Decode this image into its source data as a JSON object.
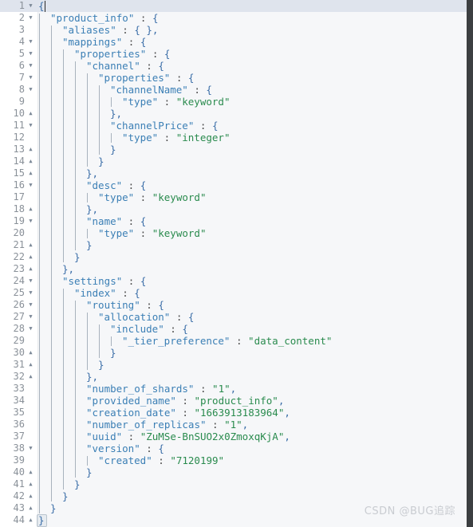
{
  "editor": {
    "language": "json",
    "total_lines": 44,
    "active_line": 1,
    "line_height": 15,
    "colors": {
      "background": "#f6f7f9",
      "gutter_background": "#ffffff",
      "active_line": "#dfe4ed",
      "line_number": "#8a9199",
      "key": "#3b7fb5",
      "string": "#2a8b4e",
      "punctuation": "#4a4a4a",
      "brace": "#3b6ea8",
      "indent_guide": "#a8b2bd",
      "right_bar": "#3c3f41"
    },
    "fold_open_glyph": "▼",
    "fold_close_glyph": "▲"
  },
  "watermark": {
    "text": "CSDN @BUG追踪"
  },
  "lines": [
    {
      "n": 1,
      "fold": "open",
      "indent": 0,
      "text": "{",
      "tokens": [
        {
          "t": "{",
          "c": "b"
        }
      ]
    },
    {
      "n": 2,
      "fold": "open",
      "indent": 1,
      "text": "\"product_info\" : {",
      "tokens": [
        {
          "t": "\"product_info\"",
          "c": "k"
        },
        {
          "t": " : ",
          "c": "p"
        },
        {
          "t": "{",
          "c": "b"
        }
      ]
    },
    {
      "n": 3,
      "fold": "none",
      "indent": 2,
      "text": "\"aliases\" : { },",
      "tokens": [
        {
          "t": "\"aliases\"",
          "c": "k"
        },
        {
          "t": " : ",
          "c": "p"
        },
        {
          "t": "{ }",
          "c": "b"
        },
        {
          "t": ",",
          "c": "c"
        }
      ]
    },
    {
      "n": 4,
      "fold": "open",
      "indent": 2,
      "text": "\"mappings\" : {",
      "tokens": [
        {
          "t": "\"mappings\"",
          "c": "k"
        },
        {
          "t": " : ",
          "c": "p"
        },
        {
          "t": "{",
          "c": "b"
        }
      ]
    },
    {
      "n": 5,
      "fold": "open",
      "indent": 3,
      "text": "\"properties\" : {",
      "tokens": [
        {
          "t": "\"properties\"",
          "c": "k"
        },
        {
          "t": " : ",
          "c": "p"
        },
        {
          "t": "{",
          "c": "b"
        }
      ]
    },
    {
      "n": 6,
      "fold": "open",
      "indent": 4,
      "text": "\"channel\" : {",
      "tokens": [
        {
          "t": "\"channel\"",
          "c": "k"
        },
        {
          "t": " : ",
          "c": "p"
        },
        {
          "t": "{",
          "c": "b"
        }
      ]
    },
    {
      "n": 7,
      "fold": "open",
      "indent": 5,
      "text": "\"properties\" : {",
      "tokens": [
        {
          "t": "\"properties\"",
          "c": "k"
        },
        {
          "t": " : ",
          "c": "p"
        },
        {
          "t": "{",
          "c": "b"
        }
      ]
    },
    {
      "n": 8,
      "fold": "open",
      "indent": 6,
      "text": "\"channelName\" : {",
      "tokens": [
        {
          "t": "\"channelName\"",
          "c": "k"
        },
        {
          "t": " : ",
          "c": "p"
        },
        {
          "t": "{",
          "c": "b"
        }
      ]
    },
    {
      "n": 9,
      "fold": "none",
      "indent": 7,
      "text": "\"type\" : \"keyword\"",
      "tokens": [
        {
          "t": "\"type\"",
          "c": "k"
        },
        {
          "t": " : ",
          "c": "p"
        },
        {
          "t": "\"keyword\"",
          "c": "s"
        }
      ]
    },
    {
      "n": 10,
      "fold": "close",
      "indent": 6,
      "text": "},",
      "tokens": [
        {
          "t": "}",
          "c": "b"
        },
        {
          "t": ",",
          "c": "c"
        }
      ]
    },
    {
      "n": 11,
      "fold": "open",
      "indent": 6,
      "text": "\"channelPrice\" : {",
      "tokens": [
        {
          "t": "\"channelPrice\"",
          "c": "k"
        },
        {
          "t": " : ",
          "c": "p"
        },
        {
          "t": "{",
          "c": "b"
        }
      ]
    },
    {
      "n": 12,
      "fold": "none",
      "indent": 7,
      "text": "\"type\" : \"integer\"",
      "tokens": [
        {
          "t": "\"type\"",
          "c": "k"
        },
        {
          "t": " : ",
          "c": "p"
        },
        {
          "t": "\"integer\"",
          "c": "s"
        }
      ]
    },
    {
      "n": 13,
      "fold": "close",
      "indent": 6,
      "text": "}",
      "tokens": [
        {
          "t": "}",
          "c": "b"
        }
      ]
    },
    {
      "n": 14,
      "fold": "close",
      "indent": 5,
      "text": "}",
      "tokens": [
        {
          "t": "}",
          "c": "b"
        }
      ]
    },
    {
      "n": 15,
      "fold": "close",
      "indent": 4,
      "text": "},",
      "tokens": [
        {
          "t": "}",
          "c": "b"
        },
        {
          "t": ",",
          "c": "c"
        }
      ]
    },
    {
      "n": 16,
      "fold": "open",
      "indent": 4,
      "text": "\"desc\" : {",
      "tokens": [
        {
          "t": "\"desc\"",
          "c": "k"
        },
        {
          "t": " : ",
          "c": "p"
        },
        {
          "t": "{",
          "c": "b"
        }
      ]
    },
    {
      "n": 17,
      "fold": "none",
      "indent": 5,
      "text": "\"type\" : \"keyword\"",
      "tokens": [
        {
          "t": "\"type\"",
          "c": "k"
        },
        {
          "t": " : ",
          "c": "p"
        },
        {
          "t": "\"keyword\"",
          "c": "s"
        }
      ]
    },
    {
      "n": 18,
      "fold": "close",
      "indent": 4,
      "text": "},",
      "tokens": [
        {
          "t": "}",
          "c": "b"
        },
        {
          "t": ",",
          "c": "c"
        }
      ]
    },
    {
      "n": 19,
      "fold": "open",
      "indent": 4,
      "text": "\"name\" : {",
      "tokens": [
        {
          "t": "\"name\"",
          "c": "k"
        },
        {
          "t": " : ",
          "c": "p"
        },
        {
          "t": "{",
          "c": "b"
        }
      ]
    },
    {
      "n": 20,
      "fold": "none",
      "indent": 5,
      "text": "\"type\" : \"keyword\"",
      "tokens": [
        {
          "t": "\"type\"",
          "c": "k"
        },
        {
          "t": " : ",
          "c": "p"
        },
        {
          "t": "\"keyword\"",
          "c": "s"
        }
      ]
    },
    {
      "n": 21,
      "fold": "close",
      "indent": 4,
      "text": "}",
      "tokens": [
        {
          "t": "}",
          "c": "b"
        }
      ]
    },
    {
      "n": 22,
      "fold": "close",
      "indent": 3,
      "text": "}",
      "tokens": [
        {
          "t": "}",
          "c": "b"
        }
      ]
    },
    {
      "n": 23,
      "fold": "close",
      "indent": 2,
      "text": "},",
      "tokens": [
        {
          "t": "}",
          "c": "b"
        },
        {
          "t": ",",
          "c": "c"
        }
      ]
    },
    {
      "n": 24,
      "fold": "open",
      "indent": 2,
      "text": "\"settings\" : {",
      "tokens": [
        {
          "t": "\"settings\"",
          "c": "k"
        },
        {
          "t": " : ",
          "c": "p"
        },
        {
          "t": "{",
          "c": "b"
        }
      ]
    },
    {
      "n": 25,
      "fold": "open",
      "indent": 3,
      "text": "\"index\" : {",
      "tokens": [
        {
          "t": "\"index\"",
          "c": "k"
        },
        {
          "t": " : ",
          "c": "p"
        },
        {
          "t": "{",
          "c": "b"
        }
      ]
    },
    {
      "n": 26,
      "fold": "open",
      "indent": 4,
      "text": "\"routing\" : {",
      "tokens": [
        {
          "t": "\"routing\"",
          "c": "k"
        },
        {
          "t": " : ",
          "c": "p"
        },
        {
          "t": "{",
          "c": "b"
        }
      ]
    },
    {
      "n": 27,
      "fold": "open",
      "indent": 5,
      "text": "\"allocation\" : {",
      "tokens": [
        {
          "t": "\"allocation\"",
          "c": "k"
        },
        {
          "t": " : ",
          "c": "p"
        },
        {
          "t": "{",
          "c": "b"
        }
      ]
    },
    {
      "n": 28,
      "fold": "open",
      "indent": 6,
      "text": "\"include\" : {",
      "tokens": [
        {
          "t": "\"include\"",
          "c": "k"
        },
        {
          "t": " : ",
          "c": "p"
        },
        {
          "t": "{",
          "c": "b"
        }
      ]
    },
    {
      "n": 29,
      "fold": "none",
      "indent": 7,
      "text": "\"_tier_preference\" : \"data_content\"",
      "tokens": [
        {
          "t": "\"_tier_preference\"",
          "c": "k"
        },
        {
          "t": " : ",
          "c": "p"
        },
        {
          "t": "\"data_content\"",
          "c": "s"
        }
      ]
    },
    {
      "n": 30,
      "fold": "close",
      "indent": 6,
      "text": "}",
      "tokens": [
        {
          "t": "}",
          "c": "b"
        }
      ]
    },
    {
      "n": 31,
      "fold": "close",
      "indent": 5,
      "text": "}",
      "tokens": [
        {
          "t": "}",
          "c": "b"
        }
      ]
    },
    {
      "n": 32,
      "fold": "close",
      "indent": 4,
      "text": "},",
      "tokens": [
        {
          "t": "}",
          "c": "b"
        },
        {
          "t": ",",
          "c": "c"
        }
      ]
    },
    {
      "n": 33,
      "fold": "none",
      "indent": 4,
      "text": "\"number_of_shards\" : \"1\",",
      "tokens": [
        {
          "t": "\"number_of_shards\"",
          "c": "k"
        },
        {
          "t": " : ",
          "c": "p"
        },
        {
          "t": "\"1\"",
          "c": "s"
        },
        {
          "t": ",",
          "c": "c"
        }
      ]
    },
    {
      "n": 34,
      "fold": "none",
      "indent": 4,
      "text": "\"provided_name\" : \"product_info\",",
      "tokens": [
        {
          "t": "\"provided_name\"",
          "c": "k"
        },
        {
          "t": " : ",
          "c": "p"
        },
        {
          "t": "\"product_info\"",
          "c": "s"
        },
        {
          "t": ",",
          "c": "c"
        }
      ]
    },
    {
      "n": 35,
      "fold": "none",
      "indent": 4,
      "text": "\"creation_date\" : \"1663913183964\",",
      "tokens": [
        {
          "t": "\"creation_date\"",
          "c": "k"
        },
        {
          "t": " : ",
          "c": "p"
        },
        {
          "t": "\"1663913183964\"",
          "c": "s"
        },
        {
          "t": ",",
          "c": "c"
        }
      ]
    },
    {
      "n": 36,
      "fold": "none",
      "indent": 4,
      "text": "\"number_of_replicas\" : \"1\",",
      "tokens": [
        {
          "t": "\"number_of_replicas\"",
          "c": "k"
        },
        {
          "t": " : ",
          "c": "p"
        },
        {
          "t": "\"1\"",
          "c": "s"
        },
        {
          "t": ",",
          "c": "c"
        }
      ]
    },
    {
      "n": 37,
      "fold": "none",
      "indent": 4,
      "text": "\"uuid\" : \"ZuMSe-BnSUO2x0ZmoxqKjA\",",
      "tokens": [
        {
          "t": "\"uuid\"",
          "c": "k"
        },
        {
          "t": " : ",
          "c": "p"
        },
        {
          "t": "\"ZuMSe-BnSUO2x0ZmoxqKjA\"",
          "c": "s"
        },
        {
          "t": ",",
          "c": "c"
        }
      ]
    },
    {
      "n": 38,
      "fold": "open",
      "indent": 4,
      "text": "\"version\" : {",
      "tokens": [
        {
          "t": "\"version\"",
          "c": "k"
        },
        {
          "t": " : ",
          "c": "p"
        },
        {
          "t": "{",
          "c": "b"
        }
      ]
    },
    {
      "n": 39,
      "fold": "none",
      "indent": 5,
      "text": "\"created\" : \"7120199\"",
      "tokens": [
        {
          "t": "\"created\"",
          "c": "k"
        },
        {
          "t": " : ",
          "c": "p"
        },
        {
          "t": "\"7120199\"",
          "c": "s"
        }
      ]
    },
    {
      "n": 40,
      "fold": "close",
      "indent": 4,
      "text": "}",
      "tokens": [
        {
          "t": "}",
          "c": "b"
        }
      ]
    },
    {
      "n": 41,
      "fold": "close",
      "indent": 3,
      "text": "}",
      "tokens": [
        {
          "t": "}",
          "c": "b"
        }
      ]
    },
    {
      "n": 42,
      "fold": "close",
      "indent": 2,
      "text": "}",
      "tokens": [
        {
          "t": "}",
          "c": "b"
        }
      ]
    },
    {
      "n": 43,
      "fold": "close",
      "indent": 1,
      "text": "}",
      "tokens": [
        {
          "t": "}",
          "c": "b"
        }
      ]
    },
    {
      "n": 44,
      "fold": "close",
      "indent": 0,
      "text": "}",
      "tokens": [
        {
          "t": "}",
          "c": "b"
        }
      ]
    }
  ]
}
